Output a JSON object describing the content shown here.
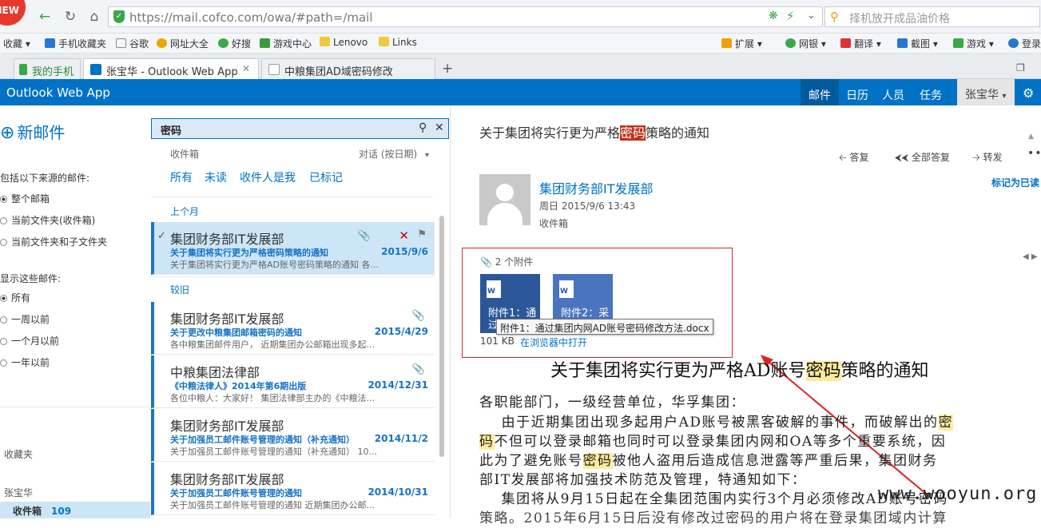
{
  "browser": {
    "new_badge": "NEW",
    "url": "https://mail.cofco.com/owa/#path=/mail",
    "search_placeholder": "择机放开成品油价格",
    "bookmarks": [
      "收藏",
      "手机收藏夹",
      "谷歌",
      "网址大全",
      "好搜",
      "游戏中心",
      "Lenovo",
      "Links"
    ],
    "tools": [
      "扩展",
      "网银",
      "翻译",
      "截图",
      "游戏",
      "登录"
    ],
    "tabs": [
      {
        "label": "我的手机"
      },
      {
        "label": "张宝华 - Outlook Web App"
      },
      {
        "label": "中粮集团AD域密码修改"
      }
    ]
  },
  "owa": {
    "title": "Outlook Web App",
    "nav": [
      "邮件",
      "日历",
      "人员",
      "任务"
    ],
    "user": "张宝华"
  },
  "left_panel": {
    "new_mail": "新邮件",
    "source_heading": "包括以下来源的邮件:",
    "source_options": [
      "整个邮箱",
      "当前文件夹(收件箱)",
      "当前文件夹和子文件夹"
    ],
    "show_heading": "显示这些邮件:",
    "show_options": [
      "所有",
      "一周以前",
      "一个月以前",
      "一年以前"
    ],
    "favorites": "收藏夹",
    "account": "张宝华",
    "inbox_label": "收件箱",
    "inbox_count": "109"
  },
  "list": {
    "search_value": "密码",
    "scope": "收件箱",
    "sort": "对话 (按日期)",
    "filters": [
      "所有",
      "未读",
      "收件人是我",
      "已标记"
    ],
    "groups": [
      "上个月",
      "较旧"
    ],
    "mails": [
      {
        "from": "集团财务部IT发展部",
        "subject": "关于集团将实行更为严格密码策略的通知",
        "date": "2015/9/6",
        "preview": "关于集团将实行更为严格AD账号密码策略的通知   各..."
      },
      {
        "from": "集团财务部IT发展部",
        "subject": "关于更改中粮集团邮箱密码的通知",
        "date": "2015/4/29",
        "preview": "各中粮集团邮件用户，  近期集团办公邮箱出现多起..."
      },
      {
        "from": "中粮集团法律部",
        "subject": "《中粮法律人》2014年第6期出版",
        "date": "2014/12/31",
        "preview": "各位中粮人：大家好！ 集团法律部主办的《中粮法..."
      },
      {
        "from": "集团财务部IT发展部",
        "subject": "关于加强员工邮件账号管理的通知（补充通知）",
        "date": "2014/11/2",
        "preview": "关于加强员工邮件账号管理的通知（补充通知）  10..."
      },
      {
        "from": "集团财务部IT发展部",
        "subject": "关于加强员工邮件账号管理的通知",
        "date": "2014/10/31",
        "preview": "关于加强员工邮件账号管理的通知   近期集团办公邮..."
      }
    ]
  },
  "reading": {
    "subject_pre": "关于集团将实行更为严格",
    "subject_hl": "密码",
    "subject_post": "策略的通知",
    "actions": [
      "答复",
      "全部答复",
      "转发"
    ],
    "sender": "集团财务部IT发展部",
    "date": "周日 2015/9/6 13:43",
    "folder": "收件箱",
    "mark_read": "标记为已读",
    "attachments_count": "2 个附件",
    "attachments": [
      {
        "name": "附件1：通过集团内网AD...",
        "short1": "附件1：通",
        "short2": "过"
      },
      {
        "name": "附件2：采",
        "short1": "附件2：采",
        "short2": ""
      }
    ],
    "att_size": "101 KB",
    "att_open": "在浏览器中打开",
    "tooltip": "附件1：通过集团内网AD账号密码修改方法.docx",
    "body_title_pre": "关于集团将实行更为严格AD账号",
    "body_title_hl": "密码",
    "body_title_post": "策略的通知",
    "body_greeting": "各职能部门，一级经营单位，华孚集团：",
    "body_l1_pre": "    由于近期集团出现多起用户AD账号被黑客破解的事件，而破解出的",
    "body_l1_hl": "密",
    "body_l2_hl": "码",
    "body_l2_post": "不但可以登录邮箱也同时可以登录集团内网和OA等多个重要系统，因",
    "body_l3_pre": "此为了避免账号",
    "body_l3_hl": "密码",
    "body_l3_post": "被他人盗用后造成信息泄露等严重后果，集团财务",
    "body_l4": "部IT发展部将加强技术防范及管理，特通知如下：",
    "body_l5": "    集团将从9月15日起在全集团范围内实行3个月必须修改AD账号密码",
    "body_l6": "策略。2015年6月15日后没有修改过密码的用户将在登录集团域内计算",
    "watermark": "www.wooyun.org"
  }
}
